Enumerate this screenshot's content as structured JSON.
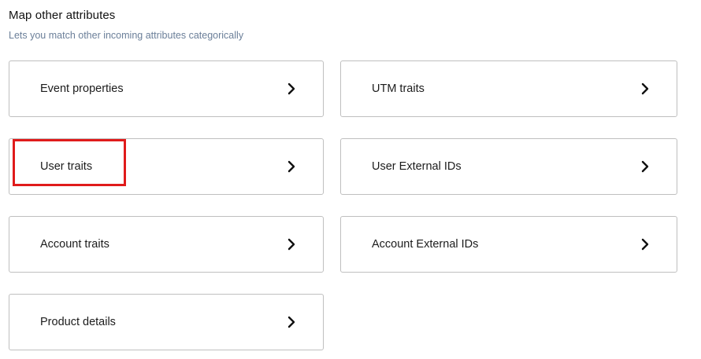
{
  "header": {
    "title": "Map other attributes",
    "subtitle": "Lets you match other incoming attributes categorically"
  },
  "cards": [
    {
      "label": "Event properties",
      "icon": "chevron-right-icon"
    },
    {
      "label": "UTM traits",
      "icon": "chevron-right-icon"
    },
    {
      "label": "User traits",
      "icon": "chevron-right-icon",
      "highlighted": true
    },
    {
      "label": "User External IDs",
      "icon": "chevron-right-icon"
    },
    {
      "label": "Account traits",
      "icon": "chevron-right-icon"
    },
    {
      "label": "Account External IDs",
      "icon": "chevron-right-icon"
    },
    {
      "label": "Product details",
      "icon": "chevron-right-icon"
    }
  ],
  "colors": {
    "highlight": "#e01b1b",
    "subtitle": "#6b7f99",
    "border": "#bfbfbf"
  }
}
